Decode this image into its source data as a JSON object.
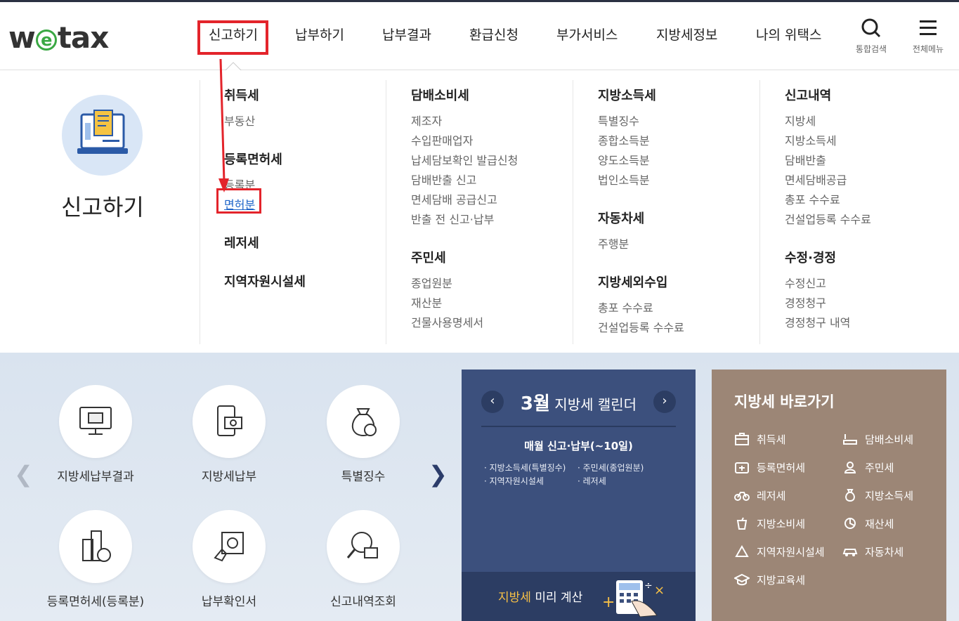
{
  "logo": {
    "pre": "w",
    "e": "e",
    "post": "tax"
  },
  "nav": [
    "신고하기",
    "납부하기",
    "납부결과",
    "환급신청",
    "부가서비스",
    "지방세정보",
    "나의 위택스"
  ],
  "util": {
    "search": "통합검색",
    "menu": "전체메뉴"
  },
  "mega": {
    "title": "신고하기",
    "col1": {
      "g1": "취득세",
      "g1_items": [
        "부동산"
      ],
      "g2": "등록면허세",
      "g2_items": [
        "등록분",
        "면허분"
      ],
      "g3": "레저세",
      "g4": "지역자원시설세"
    },
    "col2": {
      "g1": "담배소비세",
      "g1_items": [
        "제조자",
        "수입판매업자",
        "납세담보확인 발급신청",
        "담배반출 신고",
        "면세담배 공급신고",
        "반출 전 신고·납부"
      ],
      "g2": "주민세",
      "g2_items": [
        "종업원분",
        "재산분",
        "건물사용명세서"
      ]
    },
    "col3": {
      "g1": "지방소득세",
      "g1_items": [
        "특별징수",
        "종합소득분",
        "양도소득분",
        "법인소득분"
      ],
      "g2": "자동차세",
      "g2_items": [
        "주행분"
      ],
      "g3": "지방세외수입",
      "g3_items": [
        "총포 수수료",
        "건설업등록 수수료"
      ]
    },
    "col4": {
      "g1": "신고내역",
      "g1_items": [
        "지방세",
        "지방소득세",
        "담배반출",
        "면세담배공급",
        "총포 수수료",
        "건설업등록 수수료"
      ],
      "g2": "수정·경정",
      "g2_items": [
        "수정신고",
        "경정청구",
        "경정청구 내역"
      ]
    }
  },
  "services": [
    "지방세납부결과",
    "지방세납부",
    "특별징수",
    "등록면허세(등록분)",
    "납부확인서",
    "신고내역조회"
  ],
  "calendar": {
    "month": "3월",
    "title_rest": " 지방세 캘린더",
    "subtitle": "매월 신고·납부(~10일)",
    "items": [
      "지방소득세(특별징수)",
      "주민세(종업원분)",
      "지역자원시설세",
      "레저세"
    ],
    "calc_highlight": "지방세",
    "calc_rest": " 미리 계산"
  },
  "quick": {
    "title": "지방세 바로가기",
    "items": [
      "취득세",
      "담배소비세",
      "등록면허세",
      "주민세",
      "레저세",
      "지방소득세",
      "지방소비세",
      "재산세",
      "지역자원시설세",
      "자동차세",
      "지방교육세"
    ]
  },
  "colors": {
    "accent_red": "#e3242b",
    "link_blue": "#1e64c8",
    "calendar_bg": "#3c507d",
    "quick_bg": "#9c8676",
    "logo_green": "#3aa843"
  }
}
